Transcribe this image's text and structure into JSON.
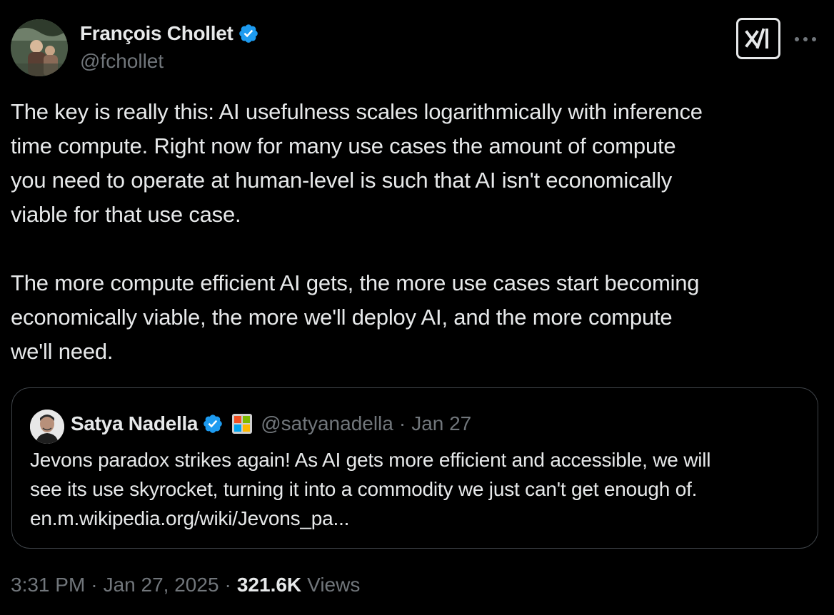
{
  "author": {
    "display_name": "François Chollet",
    "handle": "@fchollet",
    "verified_icon": "verified-badge-icon"
  },
  "header": {
    "grok_icon": "grok-icon",
    "more_icon": "more-horizontal-icon"
  },
  "tweet": {
    "paragraph1": [
      "The key is really this: AI usefulness scales logarithmically with inference",
      "time compute. Right now for many use cases the amount of compute",
      "you need to operate at human-level is such that AI isn't economically",
      "viable for that use case."
    ],
    "paragraph2": [
      "The more compute efficient AI gets, the more use cases start becoming",
      "economically viable, the more we'll deploy AI, and the more compute",
      "we'll need."
    ]
  },
  "quote": {
    "display_name": "Satya Nadella",
    "handle": "@satyanadella",
    "separator": "·",
    "date": "Jan 27",
    "affiliate_icon": "microsoft-logo-icon",
    "text": [
      "Jevons paradox strikes again! As AI gets more efficient and accessible, we will",
      "see its use skyrocket, turning it into a commodity we just can't get enough of.",
      "en.m.wikipedia.org/wiki/Jevons_pa..."
    ]
  },
  "meta": {
    "time": "3:31 PM",
    "separator1": "·",
    "date": "Jan 27, 2025",
    "separator2": "·",
    "views_count": "321.6K",
    "views_label": "Views"
  },
  "colors": {
    "background": "#000000",
    "text": "#e7e9ea",
    "secondary": "#71767b",
    "verified": "#1d9bf0",
    "border": "#3f4449"
  }
}
